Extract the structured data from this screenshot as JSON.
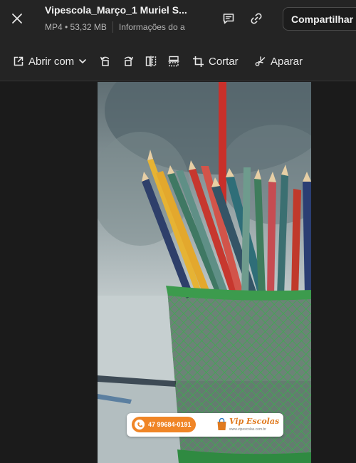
{
  "header": {
    "title": "Vipescola_Março_1 Muriel S...",
    "file_type_size": "MP4 • 53,32 MB",
    "info_label": "Informações do a",
    "share_label": "Compartilhar",
    "icons": {
      "close": "close-icon",
      "comment": "comment-icon",
      "link": "link-icon"
    }
  },
  "toolbar": {
    "open_with": "Abrir com",
    "crop": "Cortar",
    "trim": "Aparar",
    "icons": [
      "open-external-icon",
      "chevron-down-icon",
      "rotate-left-icon",
      "rotate-right-icon",
      "flip-horizontal-icon",
      "flip-vertical-icon",
      "crop-icon",
      "trim-icon"
    ]
  },
  "video_overlay": {
    "phone": "47 99684-0191",
    "brand": "Vip Escolas",
    "brand_sub": "www.vipescolas.com.br"
  },
  "colors": {
    "background": "#1f1f1f",
    "accent_orange": "#f08526",
    "cup_green": "#2f9a45"
  }
}
